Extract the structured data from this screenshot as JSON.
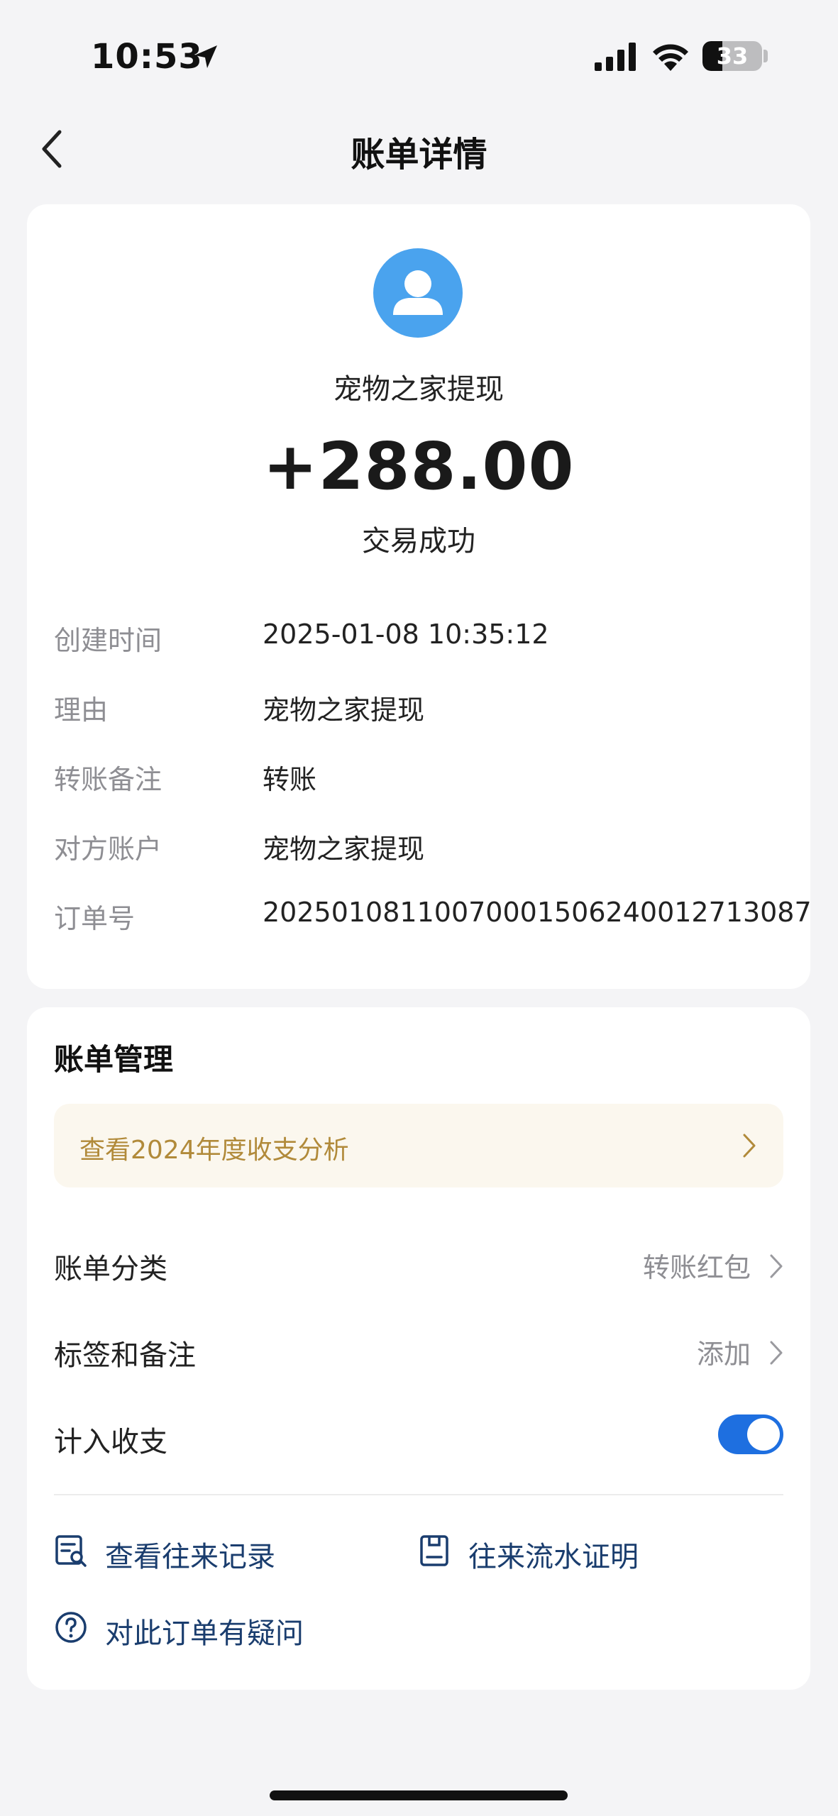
{
  "status_bar": {
    "time": "10:53",
    "battery_level": "33",
    "battery_fraction": 0.33,
    "icons": [
      "location-arrow-icon",
      "signal-icon",
      "wifi-icon",
      "battery-icon"
    ]
  },
  "nav": {
    "title": "账单详情",
    "back_icon": "chevron-left-icon"
  },
  "summary": {
    "avatar_icon": "user-avatar-icon",
    "merchant": "宠物之家提现",
    "amount": "+288.00",
    "status": "交易成功"
  },
  "details": [
    {
      "label": "创建时间",
      "value": "2025-01-08 10:35:12"
    },
    {
      "label": "理由",
      "value": "宠物之家提现"
    },
    {
      "label": "转账备注",
      "value": "转账"
    },
    {
      "label": "对方账户",
      "value": "宠物之家提现"
    },
    {
      "label": "订单号",
      "value": "20250108110070001506240012713087"
    }
  ],
  "management": {
    "title": "账单管理",
    "banner_text": "查看2024年度收支分析",
    "category_label": "账单分类",
    "category_value": "转账红包",
    "tags_label": "标签和备注",
    "tags_value": "添加",
    "include_label": "计入收支",
    "include_enabled": true
  },
  "actions": {
    "records": "查看往来记录",
    "proof": "往来流水证明",
    "question": "对此订单有疑问"
  },
  "colors": {
    "accent_blue": "#1e6fe0",
    "avatar_blue": "#4aa3ee",
    "banner_bg": "#fbf7ee",
    "banner_text": "#b18a3a",
    "action_text": "#1a3d6e",
    "label_gray": "#8e8e93"
  }
}
